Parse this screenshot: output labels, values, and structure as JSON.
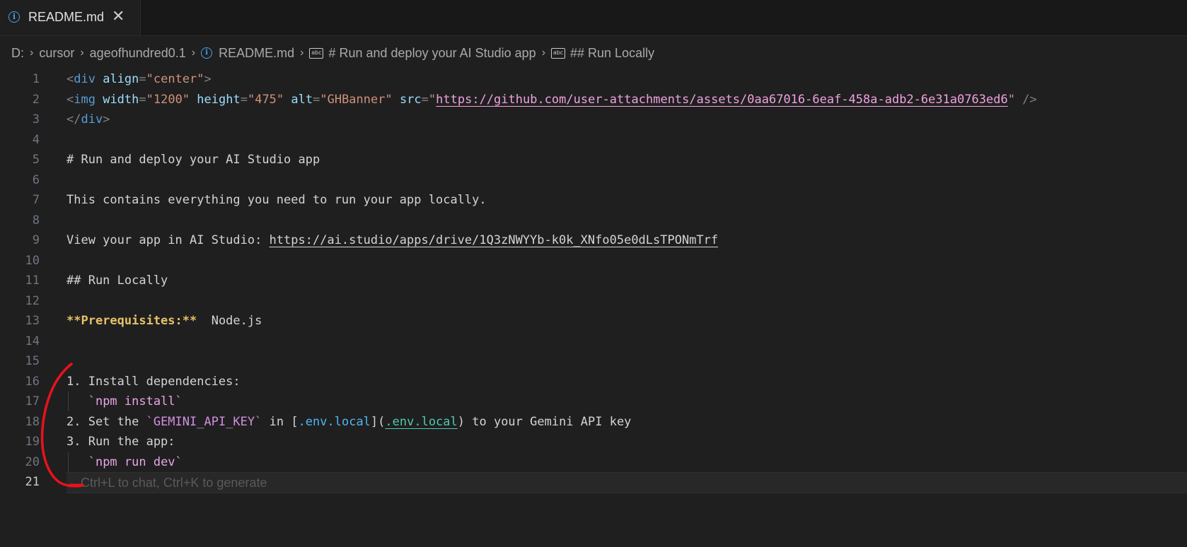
{
  "tab": {
    "icon": "info-icon",
    "label": "README.md",
    "close": "✕"
  },
  "breadcrumb": {
    "items": [
      {
        "label": "D:",
        "icon": ""
      },
      {
        "label": "cursor",
        "icon": ""
      },
      {
        "label": "ageofhundred0.1",
        "icon": ""
      },
      {
        "label": "README.md",
        "icon": "info-icon"
      },
      {
        "label": "# Run and deploy your AI Studio app",
        "icon": "abc-icon"
      },
      {
        "label": "## Run Locally",
        "icon": "abc-icon"
      }
    ],
    "separator": "›"
  },
  "editor": {
    "current_line": 21,
    "line_numbers": [
      "1",
      "2",
      "3",
      "4",
      "5",
      "6",
      "7",
      "8",
      "9",
      "10",
      "11",
      "12",
      "13",
      "14",
      "15",
      "16",
      "17",
      "18",
      "19",
      "20",
      "21"
    ],
    "lines": {
      "l1": {
        "open": "<",
        "tag": "div",
        "attr": " align",
        "eq": "=",
        "val": "\"center\"",
        "close": ">"
      },
      "l2": {
        "open": "<",
        "tag": "img",
        "a1": " width",
        "v1": "\"1200\"",
        "a2": " height",
        "v2": "\"475\"",
        "a3": " alt",
        "v3": "\"GHBanner\"",
        "a4": " src",
        "q1": "\"",
        "url": "https://github.com/user-attachments/assets/0aa67016-6eaf-458a-adb2-6e31a0763ed6",
        "q2": "\"",
        "close": " />",
        "eq": "="
      },
      "l3": {
        "open": "</",
        "tag": "div",
        "close": ">"
      },
      "l5": "# Run and deploy your AI Studio app",
      "l7": "This contains everything you need to run your app locally.",
      "l9": {
        "text": "View your app in AI Studio: ",
        "url": "https://ai.studio/apps/drive/1Q3zNWYYb-k0k_XNfo05e0dLsTPONmTrf"
      },
      "l11": "## Run Locally",
      "l13": {
        "bold": "**Prerequisites:**",
        "rest": "  Node.js"
      },
      "l16": "1. Install dependencies:",
      "l17": {
        "indent": "   ",
        "code": "`npm install`"
      },
      "l18": {
        "pre": "2. Set the ",
        "code": "`GEMINI_API_KEY`",
        "mid": " in ",
        "lb": "[",
        "linktext": ".env.local",
        "rb": "](",
        "linkurl": ".env.local",
        "rp": ")",
        "post": " to your Gemini API key"
      },
      "l19": "3. Run the app:",
      "l20": {
        "indent": "   ",
        "code": "`npm run dev`"
      },
      "l21_placeholder": "Ctrl+L to chat, Ctrl+K to generate"
    }
  },
  "colors": {
    "background": "#1f1f1f",
    "annotation": "#e8121c"
  }
}
